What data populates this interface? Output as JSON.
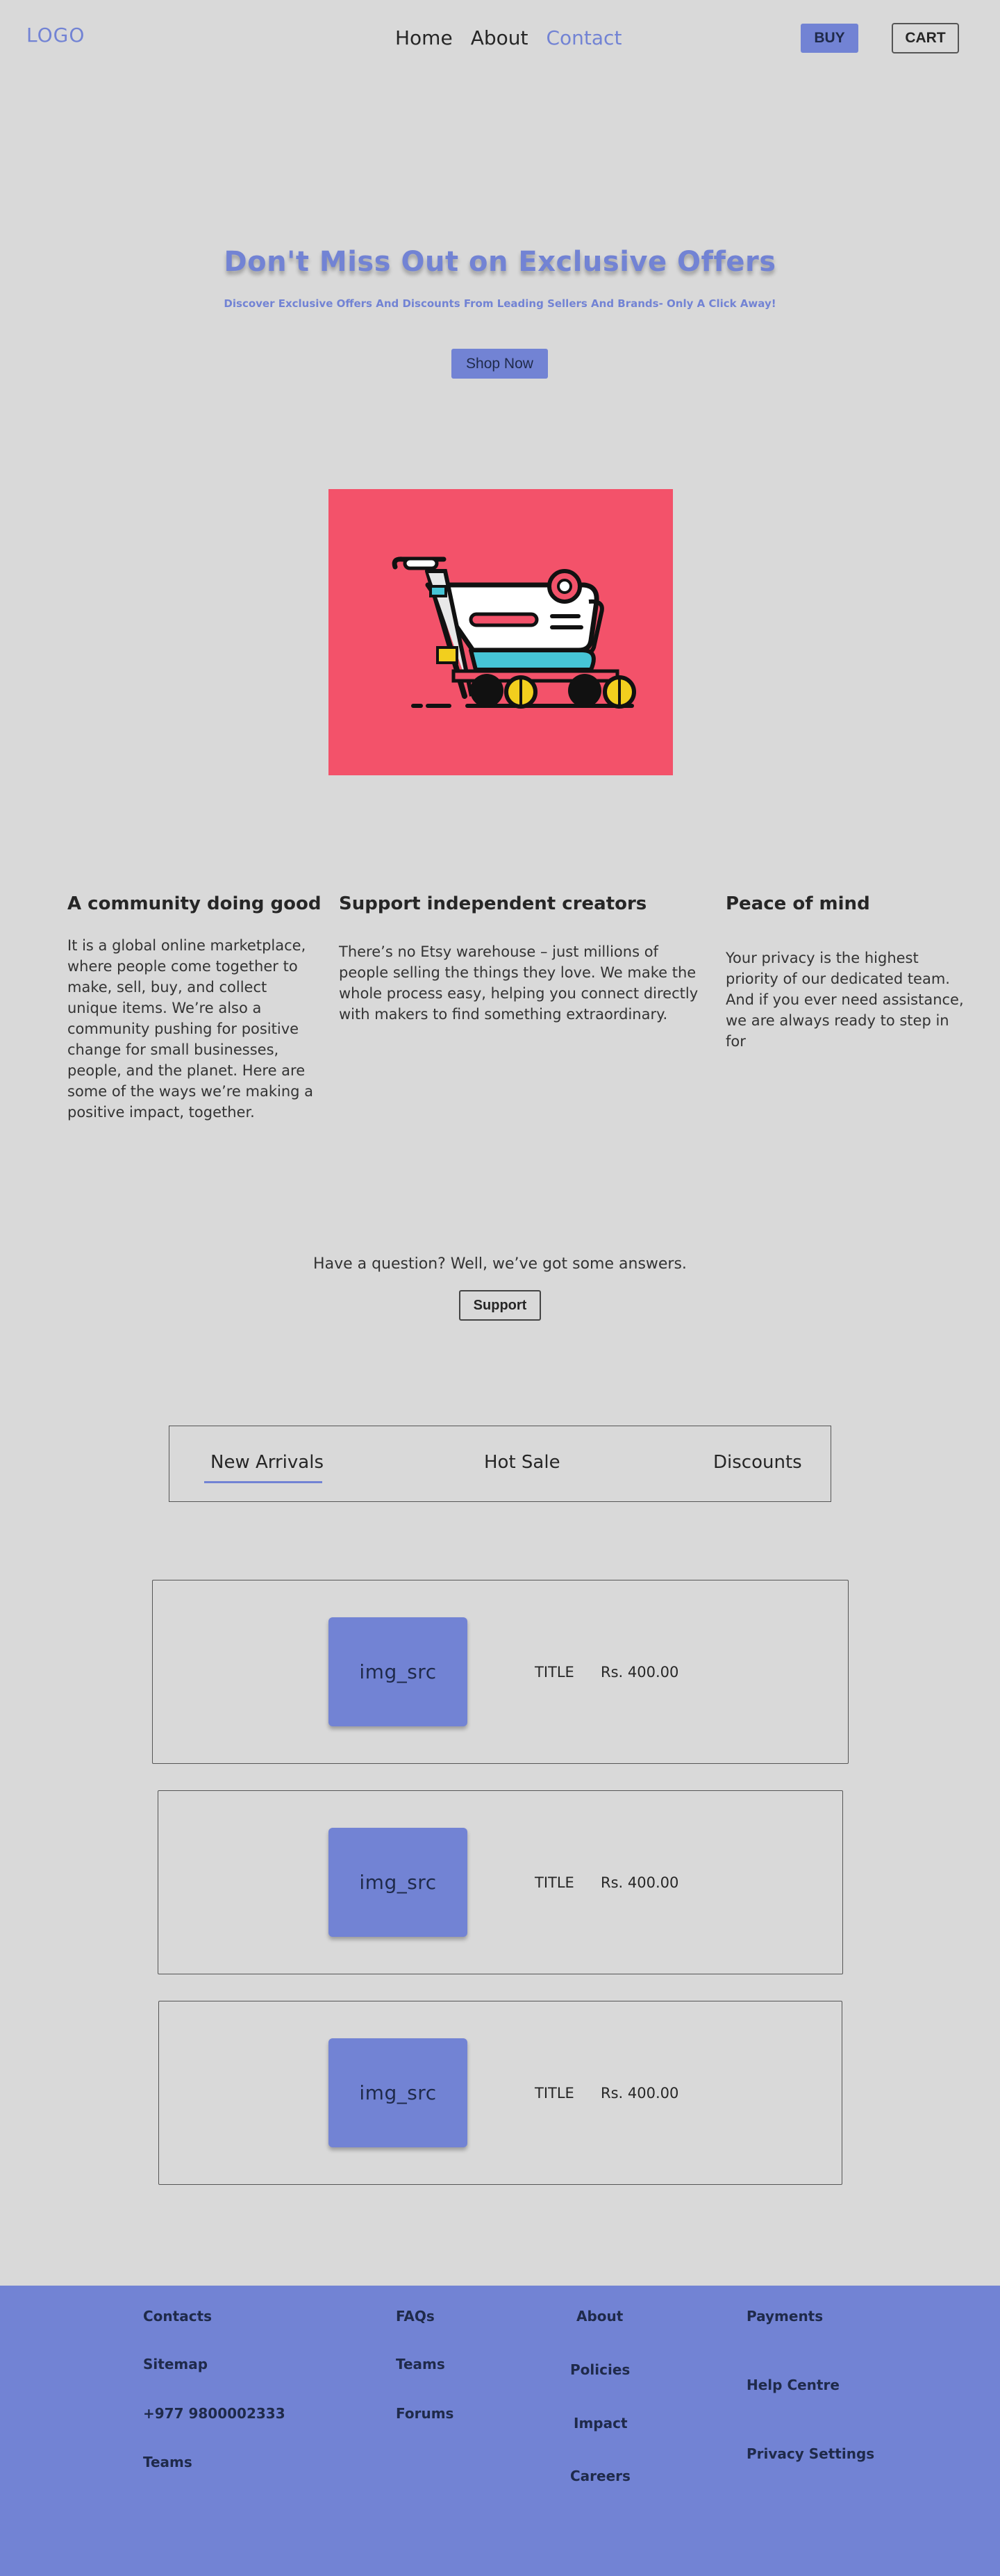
{
  "header": {
    "logo": "LOGO",
    "nav": [
      "Home",
      "About",
      "Contact"
    ],
    "active_nav": "Contact",
    "buy_label": "BUY",
    "cart_label": "CART"
  },
  "hero": {
    "title": "Don't Miss Out on Exclusive Offers",
    "subtitle": "Discover Exclusive Offers And Discounts From Leading Sellers And Brands- Only A Click Away!",
    "cta_label": "Shop Now",
    "image_icon": "shopping-cart-icon"
  },
  "features": [
    {
      "title": "A community doing good",
      "text": "It is a global online marketplace, where people come together to make, sell, buy, and collect unique items. We’re also a community pushing for positive change for small businesses, people, and the planet. Here are some of the ways we’re making a positive impact, together."
    },
    {
      "title": "Support independent creators",
      "text": "There’s no Etsy warehouse – just millions of people selling the things they love. We make the whole process easy, helping you connect directly with makers to find something extraordinary."
    },
    {
      "title": "Peace of mind",
      "text": "Your privacy is the highest priority of our dedicated team. And if you ever need assistance, we are always ready to step in for"
    }
  ],
  "support": {
    "question": "Have a question? Well, we’ve got some answers.",
    "button_label": "Support"
  },
  "tabs": {
    "items": [
      "New Arrivals",
      "Hot Sale",
      "Discounts"
    ],
    "active": "New Arrivals"
  },
  "products": [
    {
      "img": "img_src",
      "title": "TITLE",
      "price": "Rs. 400.00"
    },
    {
      "img": "img_src",
      "title": "TITLE",
      "price": "Rs. 400.00"
    },
    {
      "img": "img_src",
      "title": "TITLE",
      "price": "Rs. 400.00"
    }
  ],
  "footer": {
    "col1": [
      "Contacts",
      "Sitemap",
      "+977 9800002333",
      "Teams"
    ],
    "col2": [
      "FAQs",
      "Teams",
      "Forums"
    ],
    "col3": [
      "About",
      "Policies",
      "Impact",
      "Careers"
    ],
    "col4": [
      "Payments",
      "Help Centre",
      "Privacy Settings"
    ]
  },
  "colors": {
    "background": "#d9d9d9",
    "accent": "#7283d4",
    "hero_image_bg": "#f3526a"
  }
}
